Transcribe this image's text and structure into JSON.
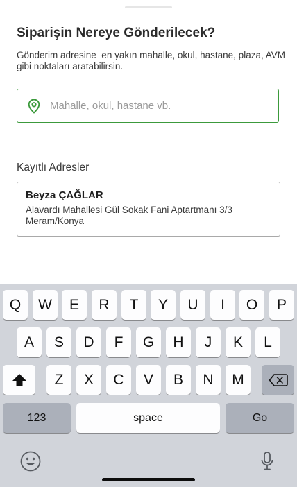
{
  "header": {
    "title": "Siparişin Nereye Gönderilecek?",
    "subtitle": "Gönderim adresine  en yakın mahalle, okul, hastane, plaza, AVM gibi noktaları aratabilirsin."
  },
  "search": {
    "placeholder": "Mahalle, okul, hastane vb.",
    "value": "",
    "icon": "location-pin-icon",
    "accent_color": "#3c9a3c"
  },
  "saved": {
    "label": "Kayıtlı Adresler",
    "items": [
      {
        "name": "Beyza ÇAĞLAR",
        "address": "Alavardı Mahallesi Gül Sokak Fani Aptartmanı 3/3 Meram/Konya"
      }
    ]
  },
  "keyboard": {
    "row1": [
      "Q",
      "W",
      "E",
      "R",
      "T",
      "Y",
      "U",
      "I",
      "O",
      "P"
    ],
    "row2": [
      "A",
      "S",
      "D",
      "F",
      "G",
      "H",
      "J",
      "K",
      "L"
    ],
    "row3": [
      "Z",
      "X",
      "C",
      "V",
      "B",
      "N",
      "M"
    ],
    "numbers_label": "123",
    "space_label": "space",
    "go_label": "Go",
    "icons": [
      "shift-icon",
      "backspace-icon",
      "emoji-icon",
      "microphone-icon"
    ]
  }
}
